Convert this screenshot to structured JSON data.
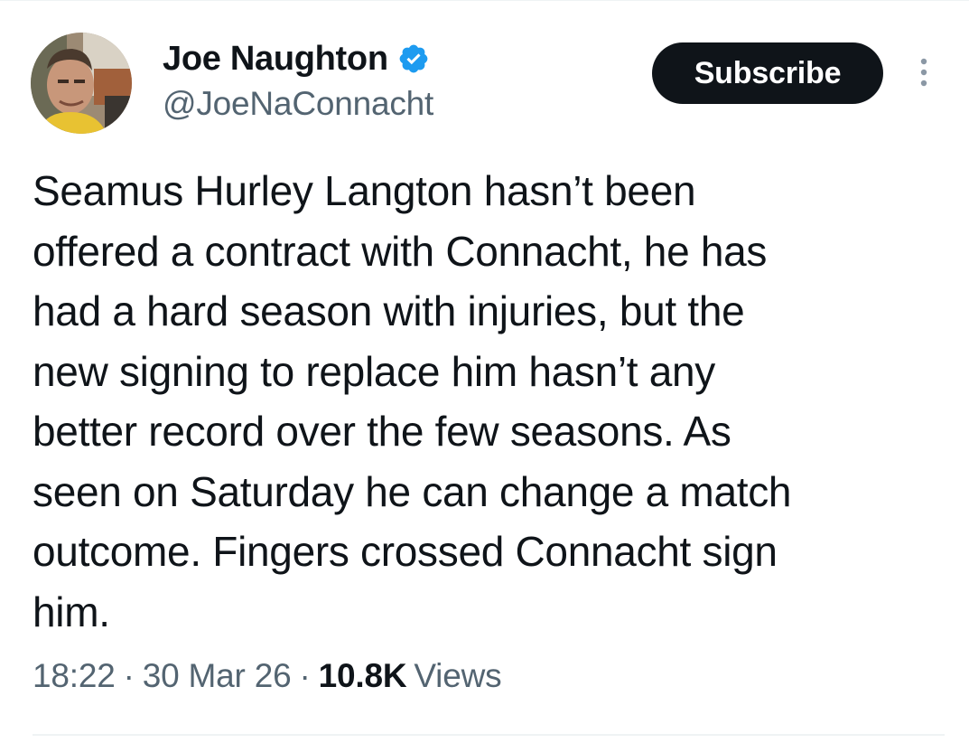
{
  "author": {
    "display_name": "Joe Naughton",
    "handle": "@JoeNaConnacht",
    "verified": true,
    "avatar_icon": "profile-photo"
  },
  "actions": {
    "subscribe_label": "Subscribe",
    "more_icon": "vertical-dots-icon"
  },
  "tweet": {
    "text": "Seamus Hurley Langton hasn’t been\noffered a contract with Connacht, he has\nhad a hard season with injuries, but the\nnew signing to replace him hasn’t any\nbetter record over the few seasons. As\nseen on Saturday he can change a match\noutcome. Fingers crossed Connacht sign\nhim."
  },
  "meta": {
    "time": "18:22",
    "separator": "·",
    "date": "30 Mar 26",
    "views_count": "10.8K",
    "views_label": "Views"
  },
  "colors": {
    "text_primary": "#0f1419",
    "text_secondary": "#536471",
    "verified_blue": "#1d9bf0",
    "button_bg": "#0f1419",
    "button_text": "#ffffff"
  }
}
